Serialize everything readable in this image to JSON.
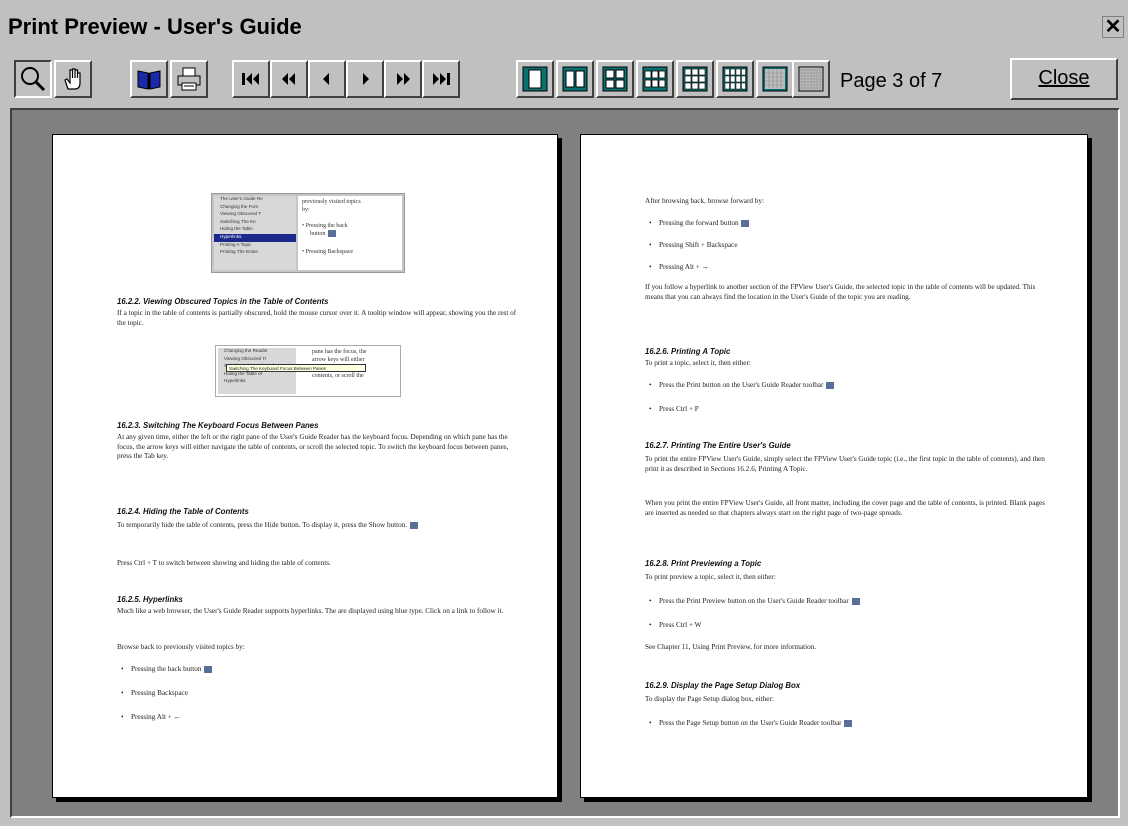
{
  "window": {
    "title": "Print Preview - User's Guide",
    "close_x": "✕"
  },
  "toolbar": {
    "page_indicator": "Page 3 of 7",
    "close_label": "Close"
  },
  "left_page": {
    "shot1_toc": [
      "The User's Guide Re",
      "Changing the Font",
      "Viewing Obscured T",
      "Switching The Ke",
      "Hiding the Table",
      "Hyperlinks",
      "Printing A Topic",
      "Printing The Entire"
    ],
    "shot1_pane": [
      "previously visited topics",
      "by:",
      "Pressing the back",
      "button",
      "Pressing Backspace"
    ],
    "s2_h": "16.2.2. Viewing Obscured Topics in the Table of Contents",
    "s2_p": "If a topic in the table of contents is partially obscured, hold the mouse cursor over it. A tooltip window will appear, showing you the rest of the topic.",
    "shot2_toc": [
      "Changing the Reader",
      "Viewing Obscured Tr",
      "Switching The Keyboard",
      "Hiding the Table of",
      "Hyperlinks"
    ],
    "shot2_tip": "Switching The Keyboard Focus Between Panes",
    "shot2_pane": [
      "pane has the focus, the",
      "arrow keys will either",
      "navigate the table of",
      "contents, or scroll the"
    ],
    "s3_h": "16.2.3. Switching The Keyboard Focus Between Panes",
    "s3_p": "At any given time, either the left or the right pane of the User's Guide Reader has the keyboard focus. Depending on which pane has the focus, the arrow keys will either navigate the table of contents, or scroll the selected topic. To switch the keyboard focus between panes, press the Tab key.",
    "s4_h": "16.2.4. Hiding the Table of Contents",
    "s4_p1": "To temporarily hide the table of contents, press the Hide button. To display it, press the Show button.",
    "s4_p2": "Press Ctrl + T to switch between showing and hiding the table of contents.",
    "s5_h": "16.2.5. Hyperlinks",
    "s5_p1": "Much like a web browser, the User's Guide Reader supports hyperlinks. The are displayed using blue type. Click on a link to follow it.",
    "s5_p2": "Browse back to previously visited topics by:",
    "s5_b1": "Pressing the back button",
    "s5_b2": "Pressing Backspace",
    "s5_b3": "Pressing Alt + ←"
  },
  "right_page": {
    "p1": "After browsing back, browse forward by:",
    "b1": "Pressing the forward button",
    "b2": "Pressing Shift + Backspace",
    "b3": "Pressing Alt + →",
    "p2": "If you follow a hyperlink to another section of the FPView User's Guide, the selected topic in the table of contents will be updated. This means that you can always find the location in the User's Guide of the topic you are reading.",
    "s6_h": "16.2.6. Printing A Topic",
    "s6_p": "To print a topic, select it, then either:",
    "s6_b1": "Press the Print button on the User's Guide Reader toolbar",
    "s6_b2": "Press Ctrl + P",
    "s7_h": "16.2.7. Printing The Entire User's Guide",
    "s7_p1": "To print the entire FPView User's Guide, simply select the FPView User's Guide topic (i.e., the first topic in the table of contents), and then print it as described in Sections 16.2.6, Printing A Topic.",
    "s7_p2": "When you print the entire FPView User's Guide, all front matter, including the cover page and the table of contents, is printed. Blank pages are inserted as needed so that chapters always start on the right page of two-page spreads.",
    "s8_h": "16.2.8. Print Previewing a Topic",
    "s8_p": "To print preview a topic, select it, then either:",
    "s8_b1": "Press the Print Preview button on the User's Guide Reader toolbar",
    "s8_b2": "Press Ctrl + W",
    "s8_p2": "See Chapter 11, Using Print Preview, for more information.",
    "s9_h": "16.2.9. Display the Page Setup Dialog Box",
    "s9_p": "To display the Page Setup dialog box, either:",
    "s9_b1": "Press the Page Setup button on the User's Guide Reader toolbar"
  }
}
